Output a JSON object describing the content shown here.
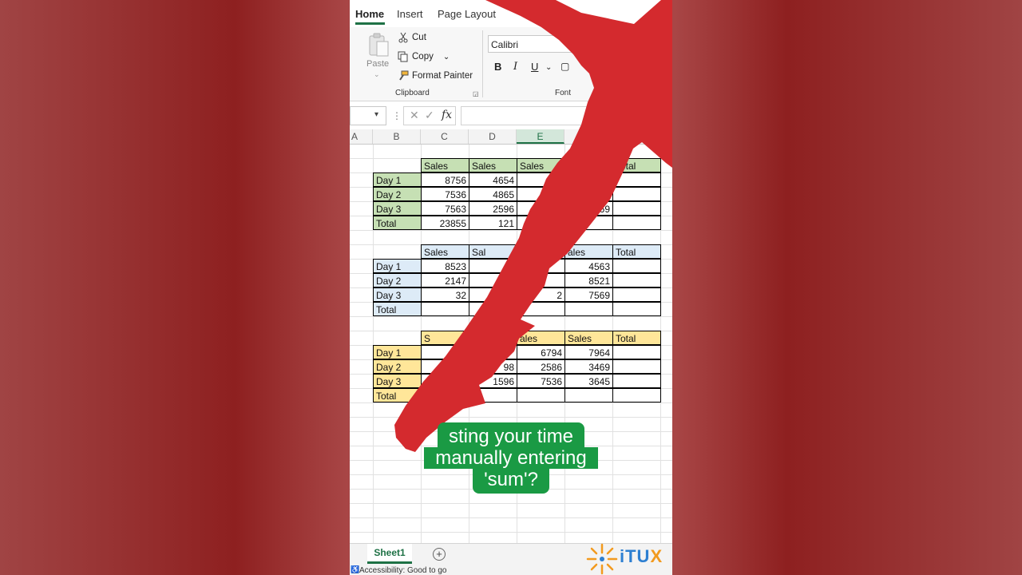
{
  "ribbon": {
    "tabs": [
      "Home",
      "Insert",
      "Page Layout"
    ],
    "active_tab": "Home",
    "clipboard": {
      "paste": "Paste",
      "cut": "Cut",
      "copy": "Copy",
      "format_painter": "Format Painter",
      "group_label": "Clipboard"
    },
    "font": {
      "name": "Calibri",
      "group_label": "Font",
      "bold": "B",
      "italic": "I",
      "underline": "U"
    }
  },
  "formula_bar": {
    "fx": "fx",
    "value": ""
  },
  "grid": {
    "columns": [
      "A",
      "B",
      "C",
      "D",
      "E"
    ],
    "active_column": "E",
    "table1": {
      "header_labels": [
        "Sales",
        "Sales",
        "Sales",
        "Total"
      ],
      "rows": [
        {
          "label": "Day 1",
          "c": "8756",
          "d": "4654"
        },
        {
          "label": "Day 2",
          "c": "7536",
          "d": "4865"
        },
        {
          "label": "Day 3",
          "c": "7563",
          "d": "2596",
          "f": "69"
        },
        {
          "label": "Total",
          "c": "23855",
          "d": "121"
        }
      ]
    },
    "table2": {
      "header_labels": [
        "Sales",
        "Sal",
        "ales",
        "Total"
      ],
      "rows": [
        {
          "label": "Day 1",
          "c": "8523",
          "f": "4563"
        },
        {
          "label": "Day 2",
          "c": "2147",
          "f": "8521"
        },
        {
          "label": "Day 3",
          "c": "32",
          "e": "2",
          "f": "7569"
        },
        {
          "label": "Total"
        }
      ]
    },
    "table3": {
      "header_labels": [
        "S",
        "ales",
        "Sales",
        "Total"
      ],
      "rows": [
        {
          "label": "Day 1",
          "e": "6794",
          "f": "7964"
        },
        {
          "label": "Day 2",
          "d": "98",
          "e": "2586",
          "f": "3469"
        },
        {
          "label": "Day 3",
          "d": "1596",
          "e": "7536",
          "f": "3645"
        },
        {
          "label": "Total"
        }
      ]
    }
  },
  "sheet_tabs": {
    "active": "Sheet1",
    "add": "+"
  },
  "status": {
    "accessibility": "Accessibility: Good to go"
  },
  "callout": {
    "line1": "sting your time",
    "line2": "manually entering",
    "line3": "'sum'?"
  },
  "logo": {
    "text_main": "iTU",
    "text_accent": "X"
  },
  "colors": {
    "excel_green": "#1e7145",
    "arrow_red": "#d42a2e",
    "callout_green": "#1a9a44",
    "table1_fill": "#c6e0b4",
    "table2_fill": "#ddebf7",
    "table3_fill": "#ffe699"
  }
}
